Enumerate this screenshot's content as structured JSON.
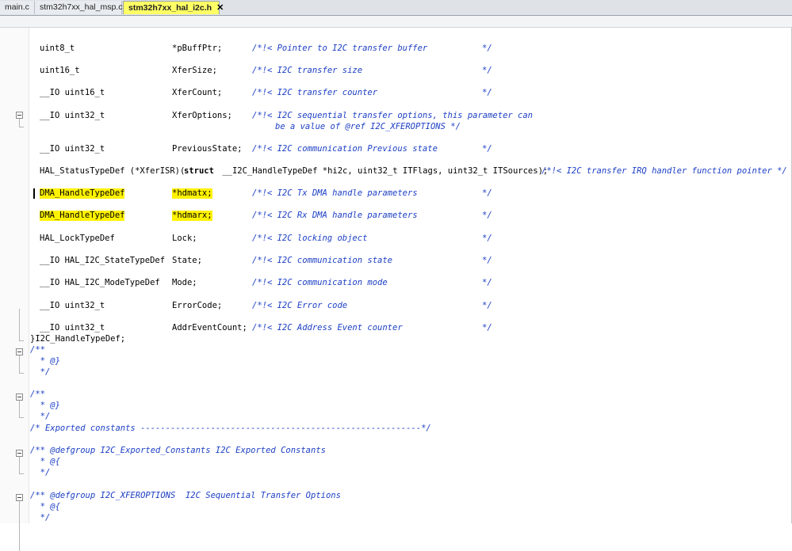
{
  "tabs": [
    {
      "label": "main.c"
    },
    {
      "label": "stm32h7xx_hal_msp.c"
    },
    {
      "label": "stm32h7xx_hal_i2c.h",
      "close": "✕"
    }
  ],
  "code": {
    "c1": {
      "t": "uint8_t",
      "n": "*pBuffPtr;",
      "c": "/*!< Pointer to I2C transfer buffer",
      "e": "*/"
    },
    "c2": {
      "t": "uint16_t",
      "n": "XferSize;",
      "c": "/*!< I2C transfer size",
      "e": "*/"
    },
    "c3": {
      "t": "__IO uint16_t",
      "n": "XferCount;",
      "c": "/*!< I2C transfer counter",
      "e": "*/"
    },
    "c4": {
      "t": "__IO uint32_t",
      "n": "XferOptions;",
      "c": "/*!< I2C sequential transfer options, this parameter can",
      "c2": "be a value of @ref I2C_XFEROPTIONS */"
    },
    "c5": {
      "t": "__IO uint32_t",
      "n": "PreviousState;",
      "c": "/*!< I2C communication Previous state",
      "e": "*/"
    },
    "c6": {
      "a": "HAL_StatusTypeDef (*XferISR)(",
      "kw": "struct",
      "b": " __I2C_HandleTypeDef *hi2c, uint32_t ITFlags, uint32_t ITSources);",
      "c": "/*!< I2C transfer IRQ handler function pointer */"
    },
    "c7": {
      "t": "DMA_HandleTypeDef",
      "n": "*hdmatx;",
      "c": "/*!< I2C Tx DMA handle parameters",
      "e": "*/"
    },
    "c8": {
      "t": "DMA_HandleTypeDef",
      "n": "*hdmarx;",
      "c": "/*!< I2C Rx DMA handle parameters",
      "e": "*/"
    },
    "c9": {
      "t": "HAL_LockTypeDef",
      "n": "Lock;",
      "c": "/*!< I2C locking object",
      "e": "*/"
    },
    "c10": {
      "t": "__IO HAL_I2C_StateTypeDef",
      "n": "State;",
      "c": "/*!< I2C communication state",
      "e": "*/"
    },
    "c11": {
      "t": "__IO HAL_I2C_ModeTypeDef",
      "n": "Mode;",
      "c": "/*!< I2C communication mode",
      "e": "*/"
    },
    "c12": {
      "t": "__IO uint32_t",
      "n": "ErrorCode;",
      "c": "/*!< I2C Error code",
      "e": "*/"
    },
    "c13": {
      "t": "__IO uint32_t",
      "n": "AddrEventCount;",
      "c": "/*!< I2C Address Event counter",
      "e": "*/"
    },
    "c14": "}I2C_HandleTypeDef;",
    "c15": "/**",
    "c16": "  * @}",
    "c17": "  */",
    "c18": "/**",
    "c19": "  * @}",
    "c20": "  */",
    "c21": "/* Exported constants --------------------------------------------------------*/",
    "c22": "/** @defgroup I2C_Exported_Constants I2C Exported Constants",
    "c23": "  * @{",
    "c24": "  */",
    "c25": "/** @defgroup I2C_XFEROPTIONS  I2C Sequential Transfer Options",
    "c26": "  * @{",
    "c27": "  */"
  }
}
